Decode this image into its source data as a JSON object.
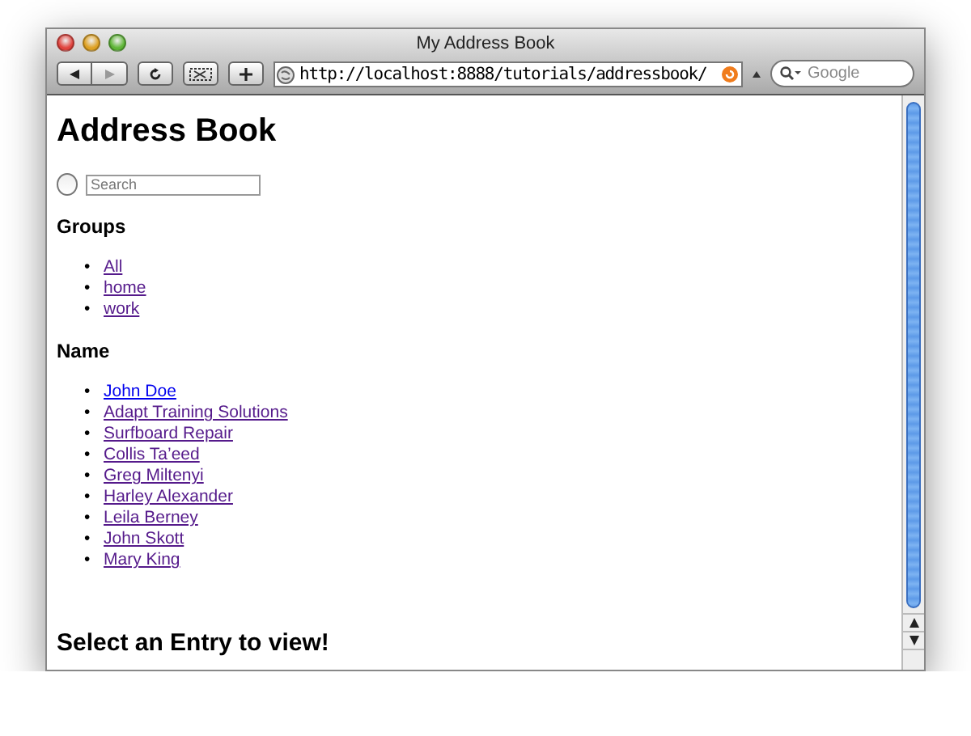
{
  "window": {
    "title": "My Address Book"
  },
  "toolbar": {
    "url": "http://localhost:8888/tutorials/addressbook/",
    "search": {
      "placeholder": "Google"
    }
  },
  "page": {
    "heading": "Address Book",
    "search": {
      "placeholder": "Search",
      "radio_checked": false
    },
    "groups": {
      "heading": "Groups",
      "items": [
        {
          "bullet": "•",
          "label": "All",
          "visited": true
        },
        {
          "bullet": "•",
          "label": "home",
          "visited": true
        },
        {
          "bullet": "•",
          "label": "work",
          "visited": true
        }
      ]
    },
    "names": {
      "heading": "Name",
      "items": [
        {
          "bullet": "•",
          "label": "John Doe",
          "visited": false
        },
        {
          "bullet": "•",
          "label": "Adapt Training Solutions",
          "visited": true
        },
        {
          "bullet": "•",
          "label": "Surfboard Repair",
          "visited": true
        },
        {
          "bullet": "•",
          "label": "Collis Ta’eed",
          "visited": true
        },
        {
          "bullet": "•",
          "label": "Greg Miltenyi",
          "visited": true
        },
        {
          "bullet": "•",
          "label": "Harley Alexander",
          "visited": true
        },
        {
          "bullet": "•",
          "label": "Leila Berney",
          "visited": true
        },
        {
          "bullet": "•",
          "label": "John Skott",
          "visited": true
        },
        {
          "bullet": "•",
          "label": "Mary King",
          "visited": true
        }
      ]
    },
    "message": "Select an Entry to view!"
  }
}
